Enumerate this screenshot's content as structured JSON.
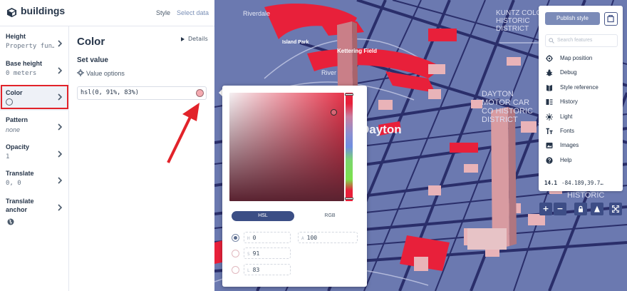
{
  "app": {
    "title": "buildings"
  },
  "tabs": {
    "style": "Style",
    "select_data": "Select data"
  },
  "properties": [
    {
      "label": "Height",
      "value": "Property fun…"
    },
    {
      "label": "Base height",
      "value": "0 meters"
    },
    {
      "label": "Color",
      "value": ""
    },
    {
      "label": "Pattern",
      "value": "none"
    },
    {
      "label": "Opacity",
      "value": "1"
    },
    {
      "label": "Translate",
      "value": "0, 0"
    },
    {
      "label": "Translate anchor",
      "value": ""
    }
  ],
  "detail": {
    "title": "Color",
    "details_link": "Details",
    "set_value": "Set value",
    "value_options": "Value options",
    "value": "hsl(0, 91%, 83%)",
    "swatch_color": "#f4aab0"
  },
  "picker": {
    "modes": {
      "hsl": "HSL",
      "rgb": "RGB"
    },
    "fields": {
      "h": "0",
      "s": "91",
      "l": "83",
      "a": "100"
    },
    "field_labels": {
      "h": "H",
      "s": "S",
      "l": "L",
      "a": "A"
    }
  },
  "right_panel": {
    "publish_label": "Publish style",
    "search_placeholder": "Search features",
    "menu": [
      {
        "label": "Map position",
        "icon": "target-icon"
      },
      {
        "label": "Debug",
        "icon": "bug-icon"
      },
      {
        "label": "Style reference",
        "icon": "book-icon"
      },
      {
        "label": "History",
        "icon": "history-icon"
      },
      {
        "label": "Light",
        "icon": "sun-icon"
      },
      {
        "label": "Fonts",
        "icon": "fonts-icon"
      },
      {
        "label": "Images",
        "icon": "image-icon"
      },
      {
        "label": "Help",
        "icon": "help-icon"
      }
    ],
    "zoom": "14.1",
    "coords": "-84.189,39.7…"
  },
  "map_labels": {
    "riverdale": "Riverdale",
    "island_park": "Island Park",
    "kettering_field": "Kettering Field",
    "river": "River",
    "dayton": "Dayton",
    "kuntz_colony": "KUNTZ COLONY HISTORIC DISTRICT",
    "dayton_motor_car": "DAYTON MOTOR CAR CO HISTORIC DISTRICT",
    "historic": "HISTORIC"
  },
  "colors": {
    "accent": "#3d4d86",
    "highlight": "#e2232a",
    "building": "#e8203a",
    "map_bg": "#6b79b0"
  }
}
